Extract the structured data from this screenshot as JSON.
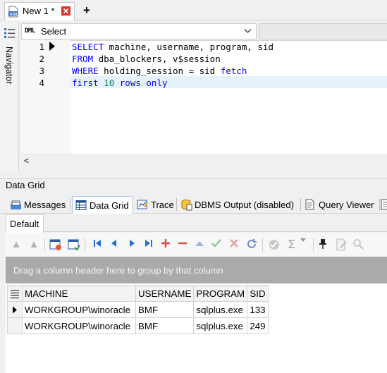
{
  "document_tab": {
    "label": "New 1 *",
    "icon": "sql-file-icon",
    "close_icon": "close-icon"
  },
  "new_tab": {
    "label": "+"
  },
  "navigator": {
    "label": "Navigator",
    "icon": "list-icon"
  },
  "editor": {
    "statement_type_tag": "DML",
    "statement_type": "Select",
    "lines": [
      {
        "number": "1",
        "text": "SELECT machine, username, program, sid"
      },
      {
        "number": "2",
        "text": "FROM dba_blockers, v$session"
      },
      {
        "number": "3",
        "text": "WHERE holding_session = sid fetch"
      },
      {
        "number": "4",
        "text": "first 10 rows only"
      }
    ],
    "scroll_left": "<"
  },
  "panel": {
    "title": "Data Grid"
  },
  "result_tabs": [
    {
      "label": "Messages",
      "icon": "messages-icon"
    },
    {
      "label": "Data Grid",
      "icon": "grid-icon",
      "active": true
    },
    {
      "label": "Trace",
      "icon": "trace-icon"
    },
    {
      "label": "DBMS Output (disabled)",
      "icon": "dbms-output-icon"
    },
    {
      "label": "Query Viewer",
      "icon": "query-viewer-icon"
    }
  ],
  "inner_tab": {
    "label": "Default"
  },
  "group_bar": {
    "text": "Drag a column header here to group by that column"
  },
  "grid": {
    "columns": [
      "MACHINE",
      "USERNAME",
      "PROGRAM",
      "SID"
    ],
    "rows": [
      [
        "WORKGROUP\\winoracle",
        "BMF",
        "sqlplus.exe",
        "133"
      ],
      [
        "WORKGROUP\\winoracle",
        "BMF",
        "sqlplus.exe",
        "249"
      ]
    ]
  },
  "colors": {
    "keyword": "#0000ff",
    "number": "#098658",
    "group_bar": "#aaaaaa",
    "nav_blue": "#1f6fd1",
    "delete_red": "#e0483b"
  }
}
